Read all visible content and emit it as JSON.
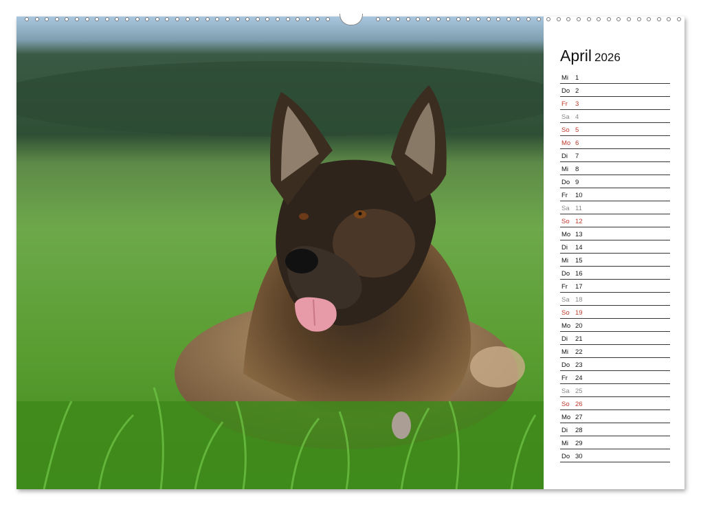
{
  "calendar": {
    "month": "April",
    "year": "2026",
    "days": [
      {
        "wd": "Mi",
        "d": "1",
        "type": "normal"
      },
      {
        "wd": "Do",
        "d": "2",
        "type": "normal"
      },
      {
        "wd": "Fr",
        "d": "3",
        "type": "red"
      },
      {
        "wd": "Sa",
        "d": "4",
        "type": "sat"
      },
      {
        "wd": "So",
        "d": "5",
        "type": "red"
      },
      {
        "wd": "Mo",
        "d": "6",
        "type": "red"
      },
      {
        "wd": "Di",
        "d": "7",
        "type": "normal"
      },
      {
        "wd": "Mi",
        "d": "8",
        "type": "normal"
      },
      {
        "wd": "Do",
        "d": "9",
        "type": "normal"
      },
      {
        "wd": "Fr",
        "d": "10",
        "type": "normal"
      },
      {
        "wd": "Sa",
        "d": "11",
        "type": "sat"
      },
      {
        "wd": "So",
        "d": "12",
        "type": "red"
      },
      {
        "wd": "Mo",
        "d": "13",
        "type": "normal"
      },
      {
        "wd": "Di",
        "d": "14",
        "type": "normal"
      },
      {
        "wd": "Mi",
        "d": "15",
        "type": "normal"
      },
      {
        "wd": "Do",
        "d": "16",
        "type": "normal"
      },
      {
        "wd": "Fr",
        "d": "17",
        "type": "normal"
      },
      {
        "wd": "Sa",
        "d": "18",
        "type": "sat"
      },
      {
        "wd": "So",
        "d": "19",
        "type": "red"
      },
      {
        "wd": "Mo",
        "d": "20",
        "type": "normal"
      },
      {
        "wd": "Di",
        "d": "21",
        "type": "normal"
      },
      {
        "wd": "Mi",
        "d": "22",
        "type": "normal"
      },
      {
        "wd": "Do",
        "d": "23",
        "type": "normal"
      },
      {
        "wd": "Fr",
        "d": "24",
        "type": "normal"
      },
      {
        "wd": "Sa",
        "d": "25",
        "type": "sat"
      },
      {
        "wd": "So",
        "d": "26",
        "type": "red"
      },
      {
        "wd": "Mo",
        "d": "27",
        "type": "normal"
      },
      {
        "wd": "Di",
        "d": "28",
        "type": "normal"
      },
      {
        "wd": "Mi",
        "d": "29",
        "type": "normal"
      },
      {
        "wd": "Do",
        "d": "30",
        "type": "normal"
      }
    ]
  },
  "colors": {
    "weekday": "#111111",
    "saturday": "#888888",
    "holiday": "#c0392b",
    "grass": "#4f9a2a",
    "sky": "#9fc0d8"
  },
  "photo": {
    "subject": "german-shepherd-dog-in-grass"
  }
}
